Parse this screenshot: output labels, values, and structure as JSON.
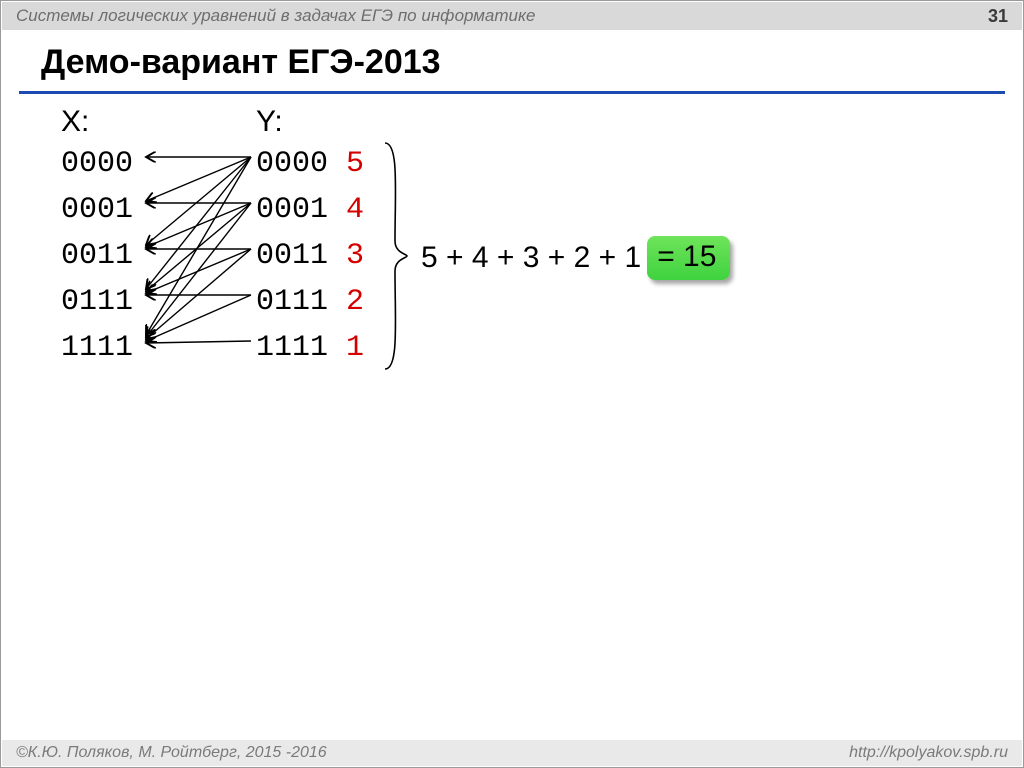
{
  "header": {
    "title": "Системы логических уравнений в задачах ЕГЭ по информатике",
    "page": "31"
  },
  "slide_title": "Демо-вариант ЕГЭ-2013",
  "columns": {
    "x_label": "X:",
    "y_label": "Y:",
    "x_values": [
      "0000",
      "0001",
      "0011",
      "0111",
      "1111"
    ],
    "y_values": [
      "0000",
      "0001",
      "0011",
      "0111",
      "1111"
    ],
    "y_counts": [
      "5",
      "4",
      "3",
      "2",
      "1"
    ]
  },
  "sum": {
    "expression": "5 + 4 + 3 + 2 + 1",
    "result": "= 15"
  },
  "footer": {
    "left": "©К.Ю. Поляков, М. Ройтберг, 2015 -2016",
    "right": "http://kpolyakov.spb.ru"
  }
}
